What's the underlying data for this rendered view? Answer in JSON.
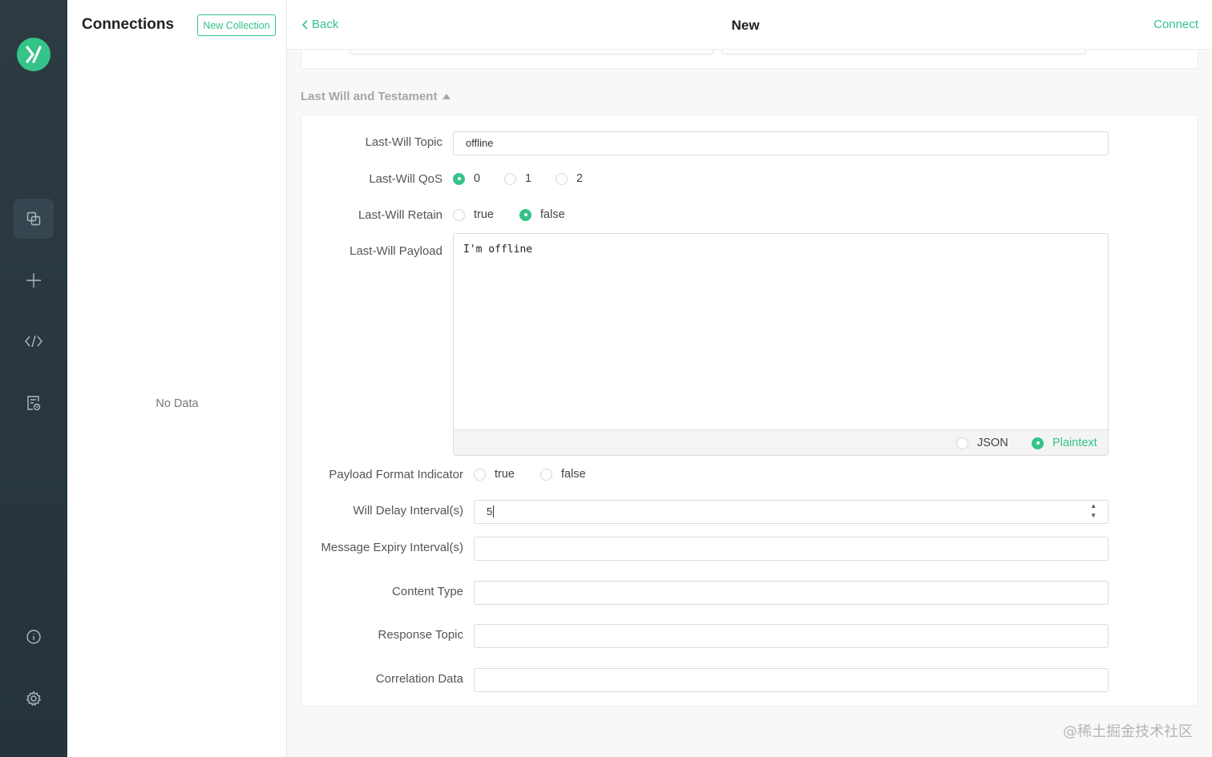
{
  "sidebar": {
    "logo_icon": "mqttx-logo",
    "items": [
      {
        "name": "connections",
        "icon": "copy-icon",
        "active": true
      },
      {
        "name": "new-connection",
        "icon": "plus-icon",
        "active": false
      },
      {
        "name": "script",
        "icon": "code-icon",
        "active": false
      },
      {
        "name": "log",
        "icon": "log-file-icon",
        "active": false
      }
    ],
    "bottom_items": [
      {
        "name": "about",
        "icon": "info-icon"
      },
      {
        "name": "settings",
        "icon": "gear-icon"
      }
    ]
  },
  "connections_panel": {
    "title": "Connections",
    "new_collection_label": "New Collection",
    "empty_text": "No Data"
  },
  "header": {
    "back_label": "Back",
    "title": "New",
    "connect_label": "Connect"
  },
  "section": {
    "title": "Last Will and Testament"
  },
  "form": {
    "last_will_topic": {
      "label": "Last-Will Topic",
      "value": "offline"
    },
    "last_will_qos": {
      "label": "Last-Will QoS",
      "options": [
        "0",
        "1",
        "2"
      ],
      "selected": "0"
    },
    "last_will_retain": {
      "label": "Last-Will Retain",
      "options": [
        "true",
        "false"
      ],
      "selected": "false"
    },
    "last_will_payload": {
      "label": "Last-Will Payload",
      "value": "I'm offline",
      "formats": [
        "JSON",
        "Plaintext"
      ],
      "selected_format": "Plaintext"
    },
    "payload_format_indicator": {
      "label": "Payload Format Indicator",
      "options": [
        "true",
        "false"
      ],
      "selected": null
    },
    "will_delay_interval": {
      "label": "Will Delay Interval(s)",
      "value": "5"
    },
    "message_expiry_interval": {
      "label": "Message Expiry Interval(s)",
      "value": ""
    },
    "content_type": {
      "label": "Content Type",
      "value": ""
    },
    "response_topic": {
      "label": "Response Topic",
      "value": ""
    },
    "correlation_data": {
      "label": "Correlation Data",
      "value": ""
    }
  },
  "watermark": "@稀土掘金技术社区",
  "colors": {
    "accent": "#34c388",
    "rail_bg": "#2a373f"
  }
}
